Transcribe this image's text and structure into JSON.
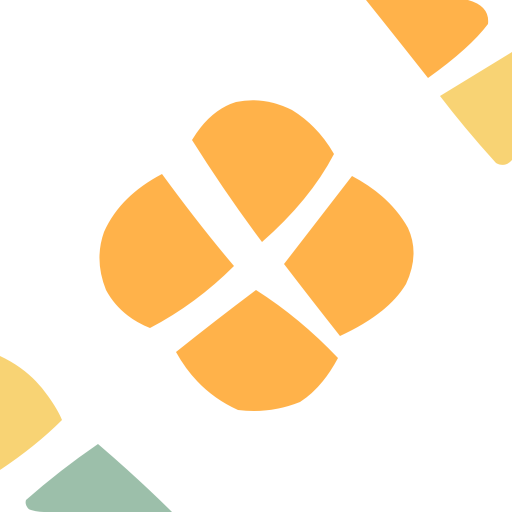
{
  "icon": {
    "name": "app-icon",
    "colors": {
      "background": "#ffffff",
      "petal": "#FFB24A",
      "corner_orange": "#FFB24A",
      "corner_yellow": "#F8D374",
      "corner_green": "#9CBFAA"
    }
  }
}
